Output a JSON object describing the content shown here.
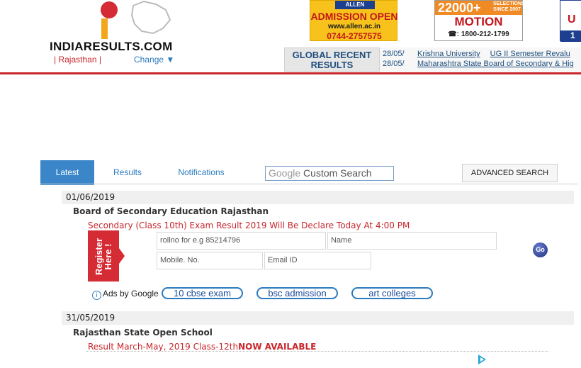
{
  "header": {
    "logo_text": "INDIARESULTS.COM",
    "state": "| Rajasthan |",
    "change": "Change ▼",
    "global_recent": "GLOBAL RECENT RESULTS",
    "ticker": [
      {
        "date": "28/05/",
        "org": "Krishna University",
        "desc": "UG II Semester Revalu"
      },
      {
        "date": "28/05/",
        "org": "Maharashtra State Board of Secondary & Hig",
        "desc": ""
      }
    ]
  },
  "ads": {
    "allen": {
      "brand": "ALLEN",
      "title": "ADMISSION OPEN",
      "url": "www.allen.ac.in",
      "phone": "0744-2757575"
    },
    "motion": {
      "count": "22000+",
      "since": "SELECTIONS SINCE 2007",
      "name": "MOTION",
      "phone": "☎: 1800-212-1799"
    },
    "third": {
      "letter": "U",
      "digit": "1"
    }
  },
  "tabs": [
    {
      "label": "Latest",
      "active": true
    },
    {
      "label": "Results",
      "active": false
    },
    {
      "label": "Notifications",
      "active": false
    }
  ],
  "search": {
    "google": "Google",
    "placeholder": "Custom Search"
  },
  "advanced_search": "ADVANCED SEARCH",
  "entries": [
    {
      "date": "01/06/2019",
      "board": "Board of Secondary Education Rajasthan",
      "link_text": "Secondary (Class 10th) Exam Result 2019 Will Be Declare Today At 4:00 PM",
      "link_suffix": ""
    },
    {
      "date": "31/05/2019",
      "board": "Rajasthan State Open School",
      "link_text": "Result March-May, 2019 Class-12th",
      "link_suffix": "NOW AVAILABLE"
    }
  ],
  "register": {
    "label": "Register Here !",
    "fields": {
      "rollno": "rollno for e.g 85214796",
      "name": "Name",
      "mobile": "Mobile. No.",
      "email": "Email ID"
    },
    "go": "Go"
  },
  "ads_by_google": {
    "label": "Ads by Google",
    "links": [
      "10 cbse exam",
      "bsc admission",
      "art colleges"
    ]
  }
}
